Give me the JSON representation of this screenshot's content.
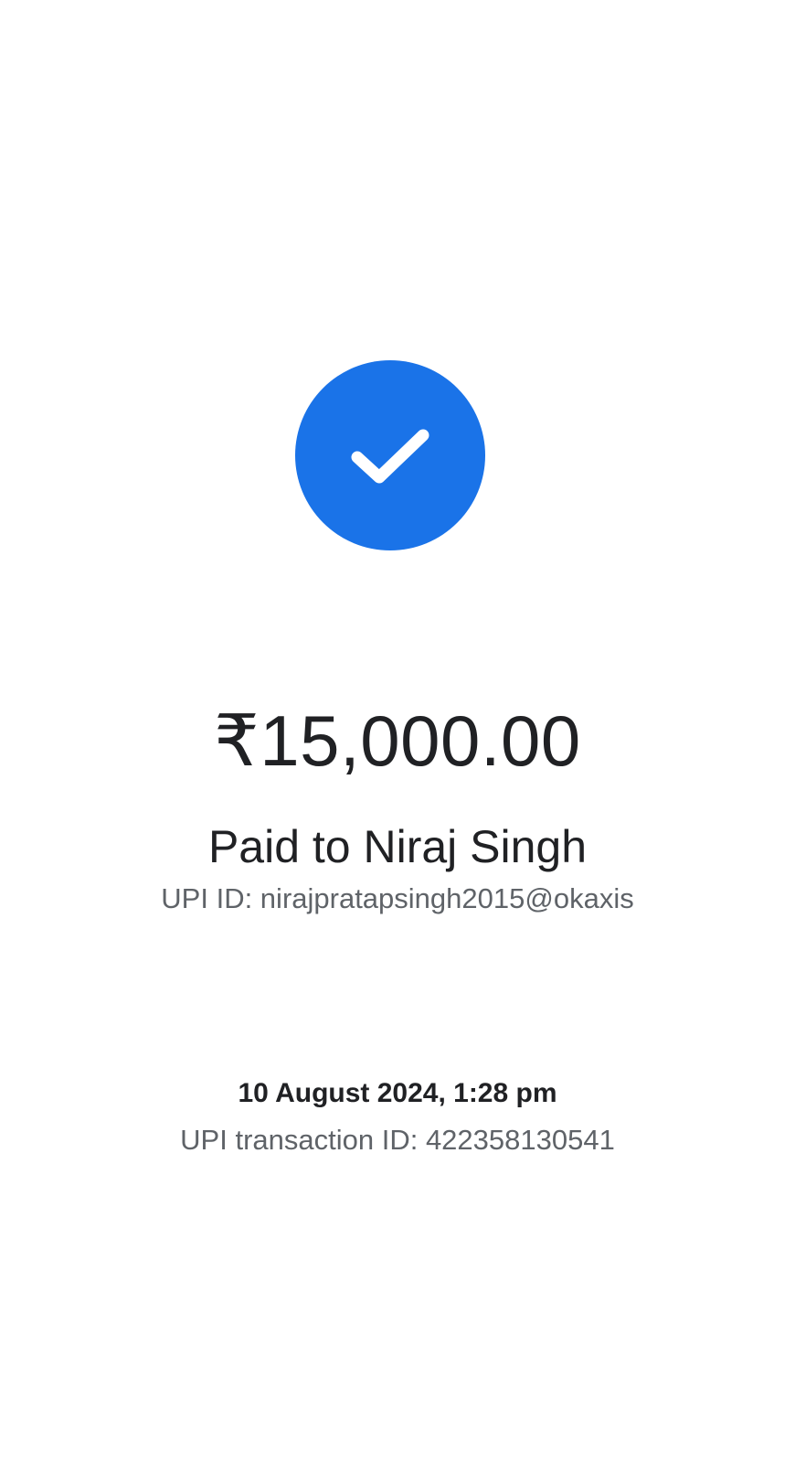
{
  "status": {
    "icon": "checkmark-icon",
    "badge_color": "#1a73e8"
  },
  "payment": {
    "amount": "₹15,000.00",
    "paid_to": "Paid to Niraj Singh",
    "upi_id": "UPI ID: nirajpratapsingh2015@okaxis"
  },
  "transaction": {
    "datetime": "10 August 2024, 1:28 pm",
    "upi_transaction_id": "UPI transaction ID: 422358130541"
  }
}
